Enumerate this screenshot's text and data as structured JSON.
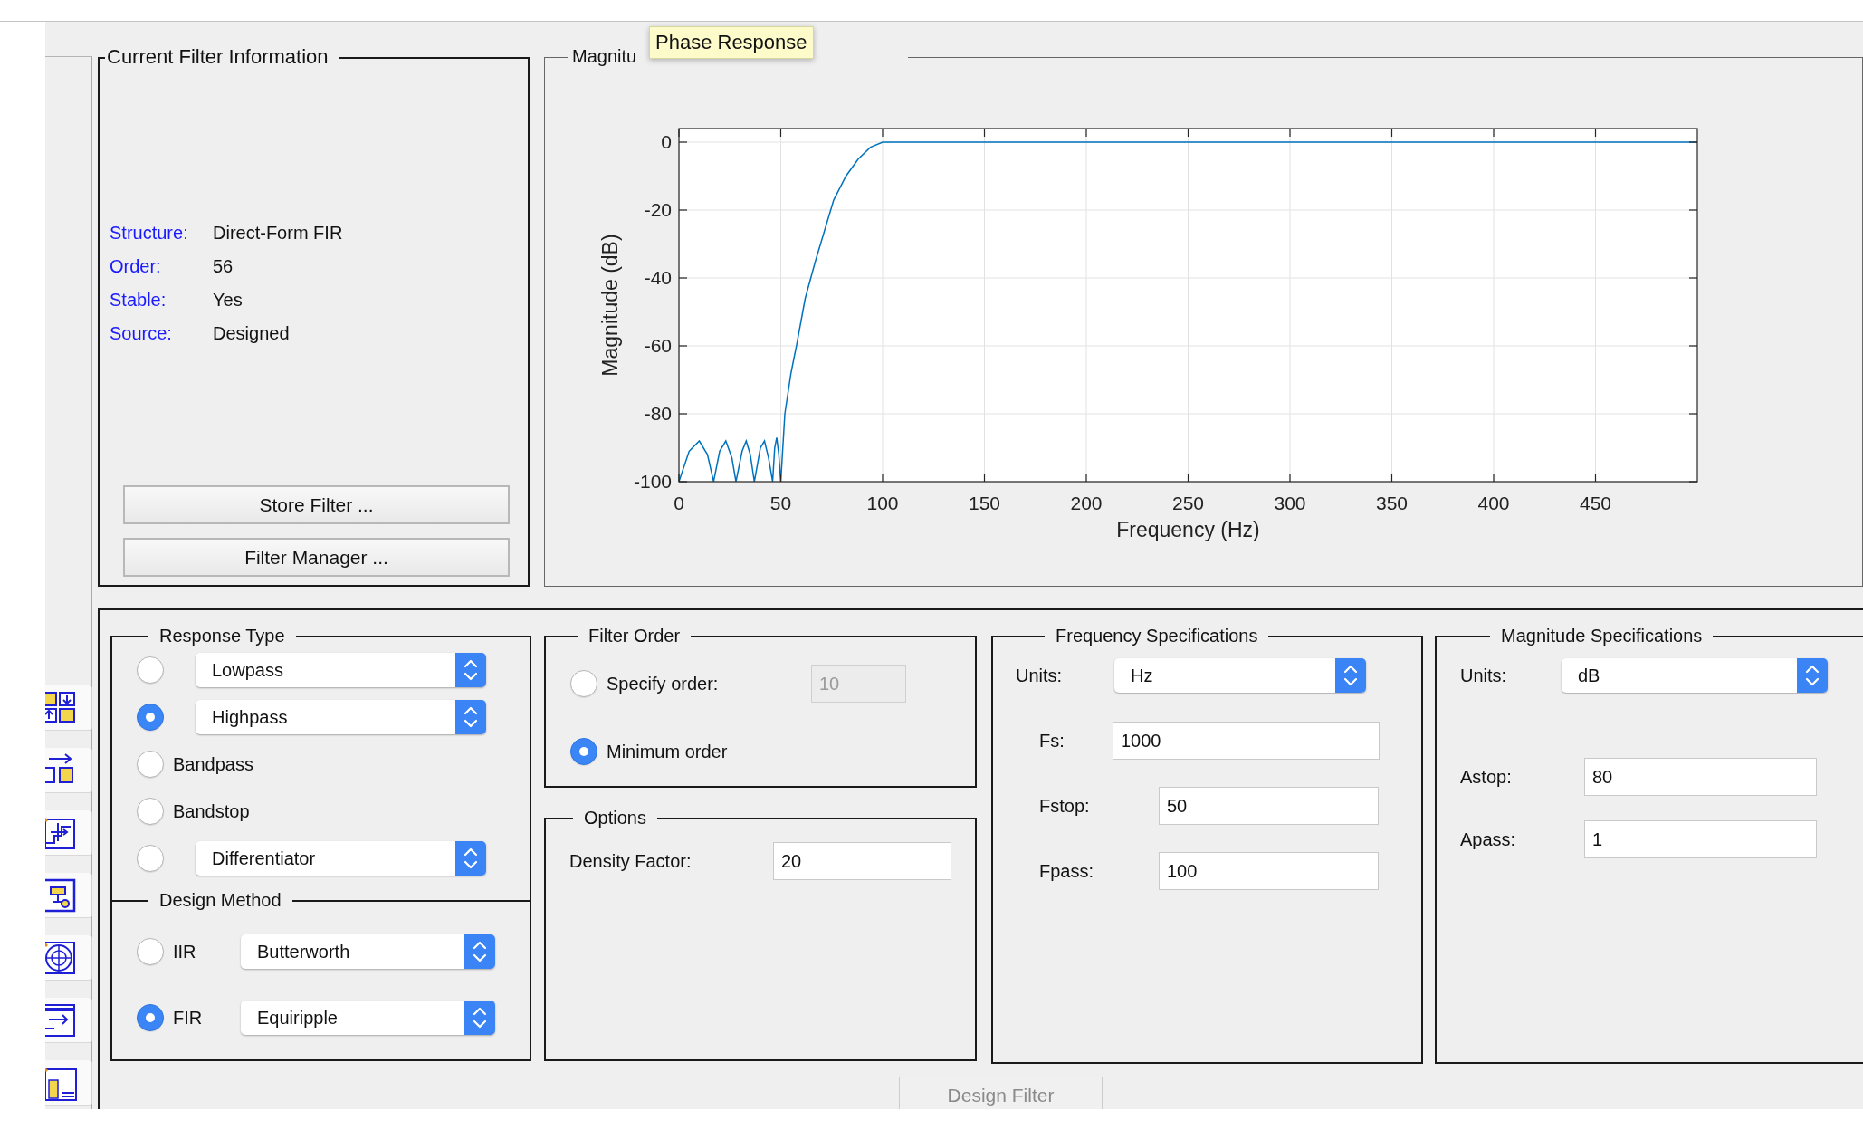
{
  "tooltip": {
    "text": "Phase Response"
  },
  "filter_info": {
    "title": "Current Filter Information",
    "rows": [
      {
        "label": "Structure:",
        "value": "Direct-Form FIR"
      },
      {
        "label": "Order:",
        "value": "56"
      },
      {
        "label": "Stable:",
        "value": "Yes"
      },
      {
        "label": "Source:",
        "value": "Designed"
      }
    ],
    "buttons": [
      "Store Filter ...",
      "Filter Manager ..."
    ]
  },
  "magnitude_response": {
    "title": "Magnitu",
    "chart_data": {
      "type": "line",
      "xlabel": "Frequency (Hz)",
      "ylabel": "Magnitude (dB)",
      "xlim": [
        0,
        500
      ],
      "ylim": [
        -100,
        4
      ],
      "grid": true,
      "xticks": [
        0,
        50,
        100,
        150,
        200,
        250,
        300,
        350,
        400,
        450
      ],
      "yticks": [
        -100,
        -80,
        -60,
        -40,
        -20,
        0
      ],
      "x": [
        0,
        5,
        10,
        14,
        17,
        20,
        23,
        26,
        28,
        31,
        33,
        35,
        37,
        40,
        42,
        44,
        46,
        47,
        48,
        49,
        50,
        52,
        55,
        58,
        62,
        67,
        72,
        76,
        82,
        88,
        94,
        100,
        150,
        200,
        250,
        300,
        350,
        400,
        450,
        500
      ],
      "series": [
        {
          "color": "#0072bd",
          "values": [
            -100,
            -91,
            -88,
            -92,
            -100,
            -91,
            -88,
            -93,
            -100,
            -91,
            -88,
            -92,
            -100,
            -90,
            -88,
            -93,
            -100,
            -90,
            -87,
            -92,
            -100,
            -80,
            -68,
            -59,
            -46,
            -35,
            -25,
            -17,
            -10,
            -5,
            -1.5,
            0,
            0,
            0,
            0,
            0,
            0,
            0,
            0,
            0
          ]
        }
      ]
    }
  },
  "response_type": {
    "title": "Response Type",
    "options": [
      {
        "kind": "select",
        "selected": false,
        "value": "Lowpass"
      },
      {
        "kind": "select",
        "selected": true,
        "value": "Highpass"
      },
      {
        "kind": "label",
        "selected": false,
        "label": "Bandpass"
      },
      {
        "kind": "label",
        "selected": false,
        "label": "Bandstop"
      },
      {
        "kind": "select",
        "selected": false,
        "value": "Differentiator"
      }
    ]
  },
  "design_method": {
    "title": "Design Method",
    "options": [
      {
        "label": "IIR",
        "selected": false,
        "value": "Butterworth"
      },
      {
        "label": "FIR",
        "selected": true,
        "value": "Equiripple"
      }
    ]
  },
  "filter_order": {
    "title": "Filter Order",
    "options": [
      {
        "label": "Specify order:",
        "selected": false,
        "field": {
          "value": "10",
          "disabled": true
        }
      },
      {
        "label": "Minimum order",
        "selected": true
      }
    ]
  },
  "options": {
    "title": "Options",
    "fields": [
      {
        "label": "Density Factor:",
        "value": "20"
      }
    ]
  },
  "frequency_specs": {
    "title": "Frequency Specifications",
    "units": {
      "label": "Units:",
      "value": "Hz"
    },
    "fields": [
      {
        "label": "Fs:",
        "value": "1000"
      },
      {
        "label": "Fstop:",
        "value": "50"
      },
      {
        "label": "Fpass:",
        "value": "100"
      }
    ]
  },
  "magnitude_specs": {
    "title": "Magnitude Specifications",
    "units": {
      "label": "Units:",
      "value": "dB"
    },
    "fields": [
      {
        "label": "Astop:",
        "value": "80"
      },
      {
        "label": "Apass:",
        "value": "1"
      }
    ]
  },
  "design_button": {
    "label": "Design Filter",
    "disabled": true
  }
}
